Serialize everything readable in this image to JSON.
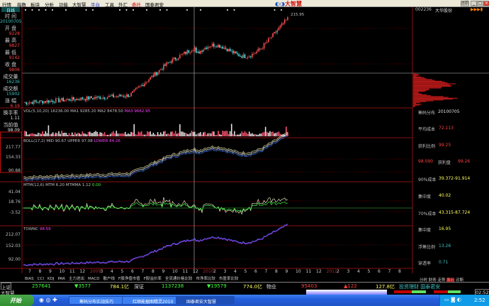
{
  "menu": [
    "行情",
    "指数",
    "板块",
    "分析",
    "功能",
    "大智慧",
    "平台",
    "工具",
    "外汇",
    "委托",
    "国泰君安"
  ],
  "logo": "大智慧",
  "window_buttons": {
    "restore_label": "还原",
    "minimize": "_",
    "maximize": "□",
    "close": "×"
  },
  "period_tab": "日线",
  "info": {
    "time_label": "时 间",
    "time": "20100705",
    "open_label": "开 盘",
    "open": "9228",
    "high_label": "最 高",
    "high": "9827",
    "low_label": "最 低",
    "low": "9142",
    "close_label": "收 盘",
    "close": "9806",
    "vol_label": "成交量",
    "vol": "16236",
    "amount_label": "成交额",
    "amount": "15902",
    "change_label": "涨 幅",
    "change": "6.19",
    "turnover_label": "换手率",
    "turnover": "1.11",
    "current_label": "当前值",
    "current": "98.09"
  },
  "price_marker": "215.95",
  "stock": {
    "code": "002236",
    "name": "大华股份"
  },
  "volume_header": {
    "name": "VOL(5,10,20)",
    "v": "16236.00",
    "ma1": "MA1 9285.20",
    "ma2": "MA2 8478.50",
    "ma3": "MA3 9662.95"
  },
  "boll": {
    "header": "BOLL(17,2) MID 90.67 UPPER 97.08",
    "lower": "LOWER 84.26",
    "axis": [
      "217.77",
      "154.33",
      "90.88"
    ]
  },
  "mtm": {
    "header": "MTM(12,6) MTM 6.20 MTMMA 1.12",
    "zero": "0.00",
    "axis": [
      "41.04",
      "18.76",
      "-3.52"
    ]
  },
  "townc": {
    "header": "TOWNC",
    "val": "98.59",
    "axis": [
      "212.07",
      "152.03",
      "92.00"
    ]
  },
  "xaxis": [
    "7",
    "8",
    "9",
    "10",
    "11",
    "12",
    "2009",
    "3",
    "4",
    "5",
    "6",
    "7",
    "8",
    "9",
    "10",
    "11",
    "12",
    "2010",
    "2",
    "3",
    "4",
    "5",
    "6",
    "7",
    "8",
    "9",
    "10",
    "11",
    "12",
    "2011",
    "2",
    "3",
    "4",
    "5",
    "6",
    "7",
    "8"
  ],
  "indicator_tabs": [
    "BIAS",
    "CCI",
    "KDJ",
    "PAR",
    "主力进出",
    "MACD",
    "散户线",
    "F股净值市值",
    "F股溢价率",
    "全流通价格比较",
    "市净率比较",
    "市盈率比较"
  ],
  "chip": {
    "title": "筹码分布",
    "date": "20100705",
    "avg_cost_label": "平均成本",
    "avg_cost": "72.113",
    "profit_ratio_label": "获利比例",
    "profit_ratio": "99.25",
    "price": "98.090",
    "profit_plate_label": "获利盘",
    "profit_plate": "99.26",
    "c90_label": "90%成本",
    "c90": "39.372-91.914",
    "conc1_label": "集中度",
    "conc1": "40.02",
    "c70_label": "70%成本",
    "c70": "43.315-87.724",
    "conc2_label": "集中度",
    "conc2": "16.95",
    "float_label": "浮筹比例",
    "float": "13.26",
    "pen_label": "穿透率",
    "pen": "0.71"
  },
  "right_tabs": [
    "分时",
    "财务",
    "走势",
    "筹码",
    "诊断"
  ],
  "status": {
    "sh_label": "上证",
    "sh_vol": "257641",
    "sh_chg": "▼3577",
    "sh_amt": "784.1亿",
    "sz_label": "深证",
    "sz_vol": "1137238",
    "sz_chg": "▼19579",
    "sz_amt": "774.0亿",
    "wy_label": "物业",
    "wy_vol": "95403",
    "wy_chg": "▲122",
    "wy_amt": "127.8亿",
    "ad": "投资理财 国泰君安"
  },
  "row2": {
    "label": "大智慧",
    "time": "02:52"
  },
  "taskbar": {
    "start": "开始",
    "tasks": [
      "筹码分布实战技巧",
      "红顺能据图精灵2010",
      "国泰君安大智慧"
    ],
    "clock": "2:52"
  },
  "colors": {
    "up": "#ff5050",
    "down": "#50e0e0",
    "grid": "#8a1010"
  }
}
